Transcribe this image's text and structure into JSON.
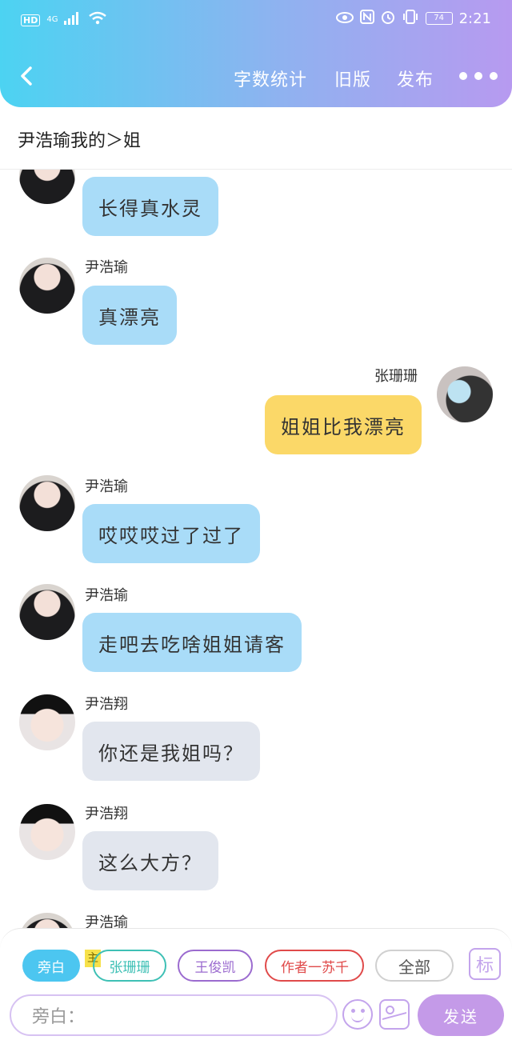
{
  "status_bar": {
    "hd": "HD",
    "network": "4G",
    "battery": "74",
    "time": "2:21"
  },
  "header": {
    "back_icon": "chevron-left-icon",
    "actions": [
      "字数统计",
      "旧版",
      "发布"
    ],
    "more_icon": "more-dots-icon"
  },
  "chat_title": "尹浩瑜我的＞姐",
  "messages": [
    {
      "sender": "",
      "text": "长得真水灵",
      "side": "left",
      "style": "blue",
      "avatar": "girl"
    },
    {
      "sender": "尹浩瑜",
      "text": "真漂亮",
      "side": "left",
      "style": "blue",
      "avatar": "girl"
    },
    {
      "sender": "张珊珊",
      "text": "姐姐比我漂亮",
      "side": "right",
      "style": "yellow",
      "avatar": "zss"
    },
    {
      "sender": "尹浩瑜",
      "text": "哎哎哎过了过了",
      "side": "left",
      "style": "blue",
      "avatar": "girl"
    },
    {
      "sender": "尹浩瑜",
      "text": "走吧去吃啥姐姐请客",
      "side": "left",
      "style": "blue",
      "avatar": "girl"
    },
    {
      "sender": "尹浩翔",
      "text": "你还是我姐吗？",
      "side": "left",
      "style": "gray",
      "avatar": "boy"
    },
    {
      "sender": "尹浩翔",
      "text": "这么大方？",
      "side": "left",
      "style": "gray",
      "avatar": "boy"
    },
    {
      "sender": "尹浩瑜",
      "text": "",
      "side": "left",
      "style": "blue",
      "avatar": "girl"
    }
  ],
  "composer": {
    "roles": [
      "旁白",
      "张珊珊",
      "王俊凯",
      "作者一苏千"
    ],
    "main_tag": "主",
    "all_label": "全部",
    "tag_label": "标",
    "input_placeholder": "旁白：",
    "emoji_icon": "emoji-icon",
    "image_icon": "image-icon",
    "send_label": "发送"
  },
  "colors": {
    "header_gradient_start": "#4cd3f2",
    "header_gradient_end": "#b79af0",
    "bubble_blue": "#a9dcf8",
    "bubble_gray": "#e2e6ee",
    "bubble_yellow": "#fbd868",
    "send_button": "#c49ae8"
  }
}
